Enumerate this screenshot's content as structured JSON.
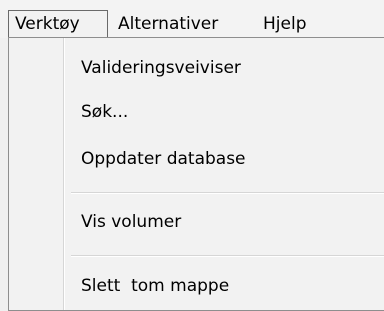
{
  "menubar": {
    "items": [
      {
        "label": "Verktøy"
      },
      {
        "label": "Alternativer"
      },
      {
        "label": "Hjelp"
      }
    ]
  },
  "dropdown": {
    "items": [
      {
        "label": "Valideringsveiviser"
      },
      {
        "label": "Søk..."
      },
      {
        "label": "Oppdater database"
      },
      {
        "label": "Vis volumer"
      },
      {
        "label": "Slett  tom mappe"
      }
    ]
  }
}
